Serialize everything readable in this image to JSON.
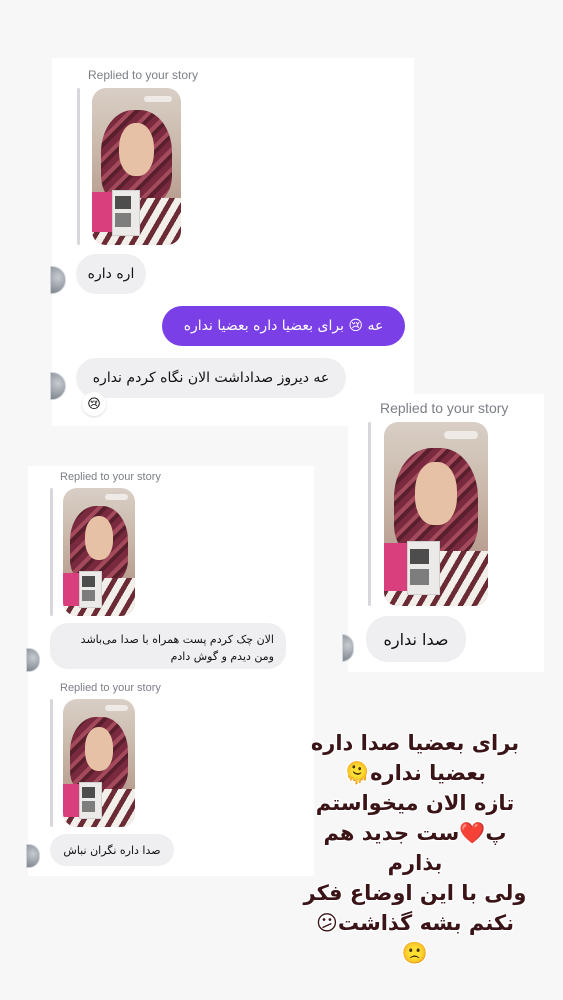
{
  "screenshot_1": {
    "replied_label": "Replied to your story",
    "reply_1": "اره داره",
    "sent_message": "عه 😢 برای بعضیا داره بعضیا نداره",
    "reply_2": "عه دیروز صداداشت الان نگاه کردم نداره",
    "reply_2_reaction": "😢"
  },
  "screenshot_2": {
    "replied_label": "Replied to your story",
    "reply": "صدا نداره"
  },
  "screenshot_3": {
    "replied_label_1": "Replied to your story",
    "reply_1_line1": "الان چک کردم پست همراه با صدا می‌باشد",
    "reply_1_line2": "ومن دیدم و گوش دادم",
    "replied_label_2": "Replied to your story",
    "reply_2": "صدا داره نگران نباش"
  },
  "caption": {
    "line1": "برای بعضیا صدا داره",
    "line2": "بعضیا نداره🫠",
    "line3": "تازه الان میخواستم",
    "line4": "پ❤️ست جدید هم بذارم",
    "line5": "ولی با این اوضاع فکر",
    "line6": "نکنم بشه گذاشت😕",
    "line7": "🙁"
  },
  "colors": {
    "sent_bubble": "#7b3fe8",
    "received_bubble": "#efeff1",
    "caption_text": "#3a1416"
  }
}
